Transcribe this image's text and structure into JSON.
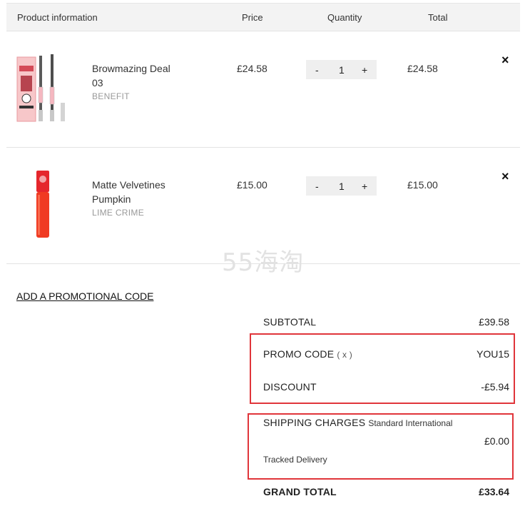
{
  "table_header": {
    "product": "Product information",
    "price": "Price",
    "quantity": "Quantity",
    "total": "Total"
  },
  "items": [
    {
      "name": "Browmazing Deal 03",
      "brand": "BENEFIT",
      "price": "£24.58",
      "quantity": "1",
      "total": "£24.58",
      "minus": "-",
      "plus": "+",
      "remove": "×",
      "image": "brow-pencil-kit-image"
    },
    {
      "name": "Matte Velvetines Pumpkin",
      "brand": "LIME CRIME",
      "price": "£15.00",
      "quantity": "1",
      "total": "£15.00",
      "minus": "-",
      "plus": "+",
      "remove": "×",
      "image": "red-lip-gloss-image"
    }
  ],
  "watermark": "55海淘",
  "promo_link": "ADD A PROMOTIONAL CODE",
  "summary": {
    "subtotal_label": "SUBTOTAL",
    "subtotal_value": "£39.58",
    "promo_label": "PROMO CODE",
    "promo_remove": "( x )",
    "promo_value": "YOU15",
    "discount_label": "DISCOUNT",
    "discount_value": "-£5.94",
    "shipping_label": "SHIPPING CHARGES",
    "shipping_method": "Standard International",
    "shipping_value": "£0.00",
    "shipping_note": "Tracked Delivery",
    "grand_label": "GRAND TOTAL",
    "grand_value": "£33.64"
  },
  "colors": {
    "highlight": "#e0353a",
    "header_bg": "#f3f3f3",
    "qty_bg": "#efefef"
  }
}
